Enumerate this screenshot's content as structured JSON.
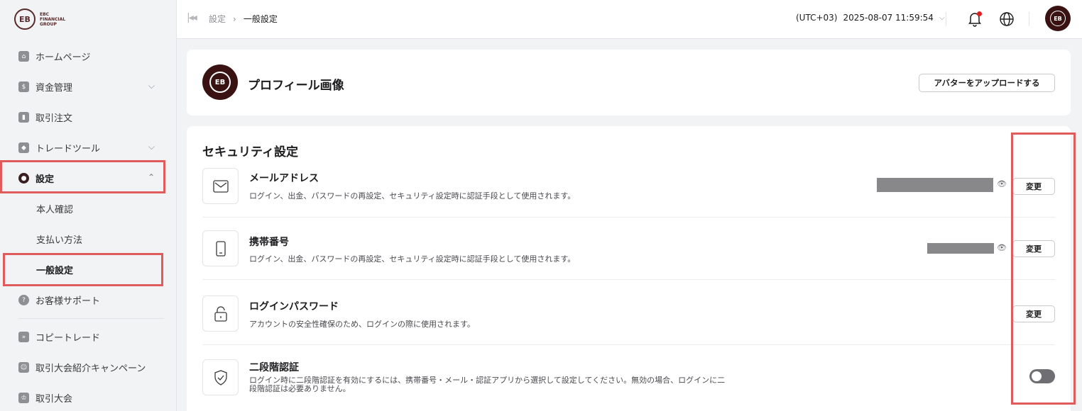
{
  "logo": {
    "mark": "EB",
    "text_line1": "EBC",
    "text_line2": "FINANCIAL",
    "text_line3": "GROUP"
  },
  "sidebar": {
    "items": [
      {
        "label": "ホームページ",
        "icon": "home-icon"
      },
      {
        "label": "資金管理",
        "icon": "wallet-icon"
      },
      {
        "label": "取引注文",
        "icon": "chart-icon"
      },
      {
        "label": "トレードツール",
        "icon": "box-icon"
      },
      {
        "label": "設定",
        "icon": "user-circle-icon"
      },
      {
        "label": "本人確認"
      },
      {
        "label": "支払い方法"
      },
      {
        "label": "一般設定"
      },
      {
        "label": "お客様サポート",
        "icon": "help-icon"
      },
      {
        "label": "コピートレード",
        "icon": "copy-trade-icon"
      },
      {
        "label": "取引大会紹介キャンペーン",
        "icon": "referral-icon"
      },
      {
        "label": "取引大会",
        "icon": "trophy-icon"
      }
    ]
  },
  "header": {
    "breadcrumb": [
      "設定",
      "一般設定"
    ],
    "breadcrumb_sep": "›",
    "timezone": "(UTC+03)",
    "datetime": "2025-08-07 11:59:54"
  },
  "profile": {
    "title": "プロフィール画像",
    "upload_label": "アバターをアップロードする"
  },
  "security": {
    "title": "セキュリティ設定",
    "rows": [
      {
        "title": "メールアドレス",
        "desc": "ログイン、出金、パスワードの再設定、セキュリティ設定時に認証手段として使用されます。",
        "action": "変更"
      },
      {
        "title": "携帯番号",
        "desc": "ログイン、出金、パスワードの再設定、セキュリティ設定時に認証手段として使用されます。",
        "action": "変更"
      },
      {
        "title": "ログインパスワード",
        "desc": "アカウントの安全性確保のため、ログインの際に使用されます。",
        "action": "変更"
      },
      {
        "title": "二段階認証",
        "desc_line1": "ログイン時に二段階認証を有効にするには、携帯番号・メール・認証アプリから選択して設定してください。無効の場合、ログインに二",
        "desc_line2": "段階認証は必要ありません。",
        "toggle": false
      }
    ]
  },
  "colors": {
    "brand": "#3a1212",
    "highlight": "#e05b5b",
    "toggle_off": "#6e6e73"
  }
}
